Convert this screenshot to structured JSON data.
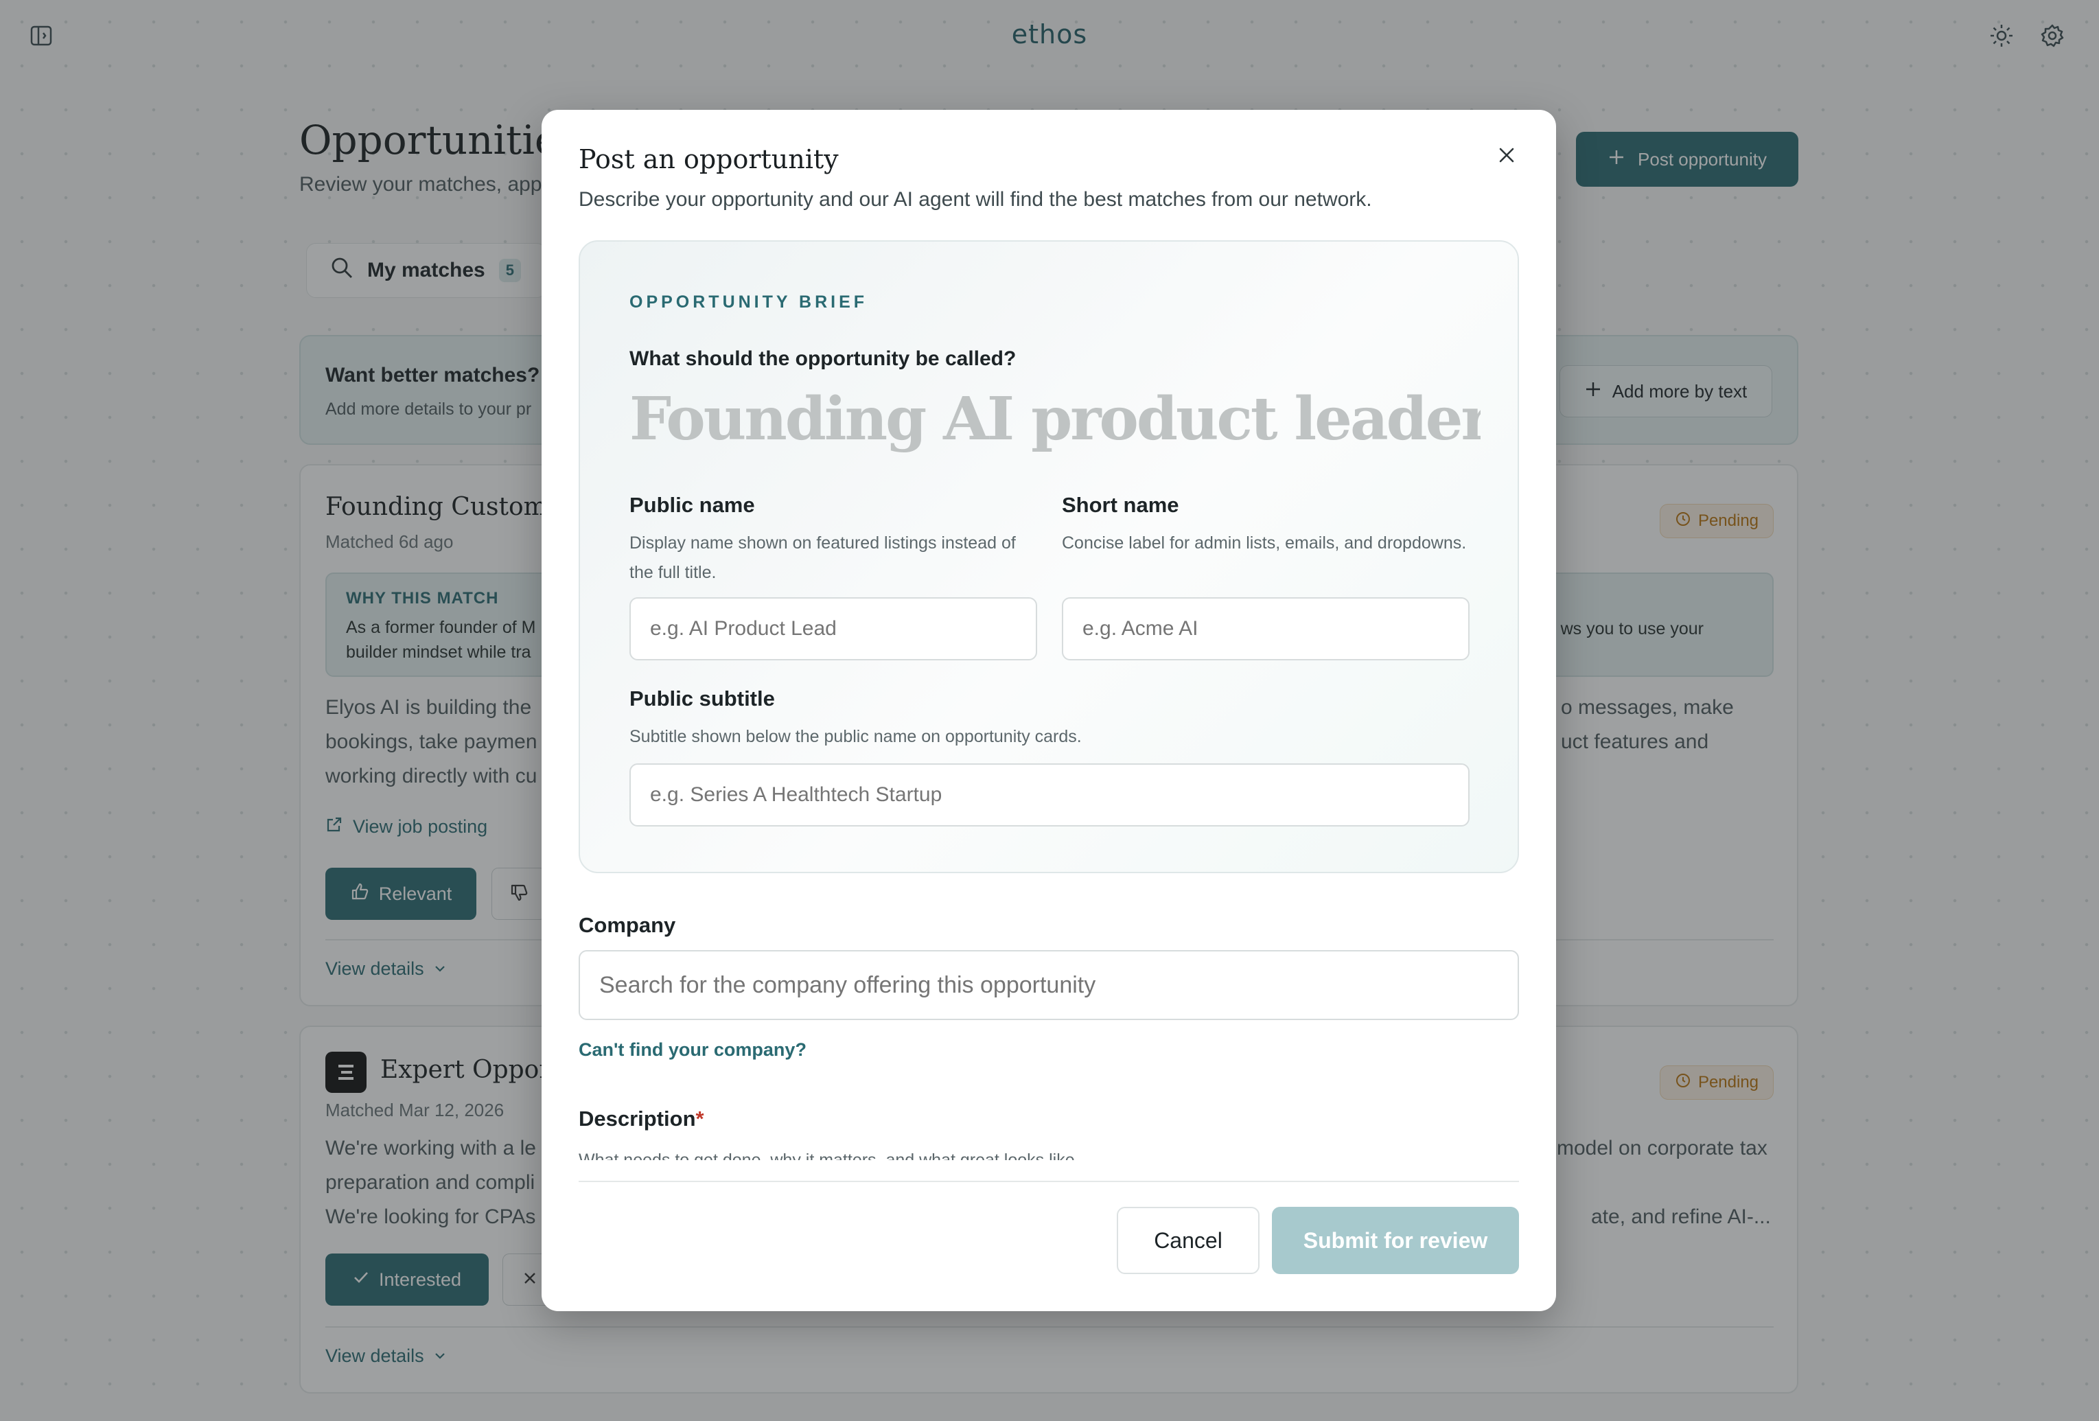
{
  "app": {
    "logo": "ethos"
  },
  "page": {
    "title": "Opportunities",
    "subtitle": "Review your matches, app",
    "post_button": "Post opportunity",
    "tab": {
      "label": "My matches",
      "count": "5"
    },
    "banner": {
      "title": "Want better matches?",
      "text": "Add more details to your pr",
      "button": "Add more by text"
    }
  },
  "cards": [
    {
      "title": "Founding Customer",
      "meta": "Matched 6d ago",
      "status": "Pending",
      "why_title": "WHY THIS MATCH",
      "why_line1": "As a former founder of M",
      "why_line2": "builder mindset while tra",
      "why_right": "ws you to use your",
      "body_l1": "Elyos AI is building the",
      "body_l2": "bookings, take paymen",
      "body_l3": "working directly with cu",
      "body_r1": "o messages, make",
      "body_r2": "uct features and",
      "link": "View job posting",
      "primary_action": "Relevant",
      "details": "View details"
    },
    {
      "title": "Expert Opport",
      "meta": "Matched Mar 12, 2026",
      "status": "Pending",
      "body_l1": "We're working with a le",
      "body_l2": "preparation and compli",
      "body_l3": "We're looking for CPAs",
      "body_r1": "model on corporate tax",
      "body_r2": "ate, and refine AI-...",
      "primary_action": "Interested",
      "details": "View details"
    }
  ],
  "modal": {
    "title": "Post an opportunity",
    "description": "Describe your opportunity and our AI agent will find the best matches from our network.",
    "brief": {
      "label": "OPPORTUNITY BRIEF",
      "question": "What should the opportunity be called?",
      "title_value": "Founding AI product leader for a hea"
    },
    "public_name": {
      "label": "Public name",
      "help": "Display name shown on featured listings instead of the full title.",
      "placeholder": "e.g. AI Product Lead"
    },
    "short_name": {
      "label": "Short name",
      "help": "Concise label for admin lists, emails, and dropdowns.",
      "placeholder": "e.g. Acme AI"
    },
    "public_subtitle": {
      "label": "Public subtitle",
      "help": "Subtitle shown below the public name on opportunity cards.",
      "placeholder": "e.g. Series A Healthtech Startup"
    },
    "company": {
      "label": "Company",
      "placeholder": "Search for the company offering this opportunity",
      "cant_find": "Can't find your company?"
    },
    "description_field": {
      "label": "Description",
      "required_mark": "*",
      "help": "What needs to get done, why it matters, and what great looks like."
    },
    "cancel": "Cancel",
    "submit": "Submit for review"
  },
  "colors": {
    "accent": "#2a6a72",
    "pending": "#b9730e",
    "submit_disabled": "#a7c9cd"
  }
}
